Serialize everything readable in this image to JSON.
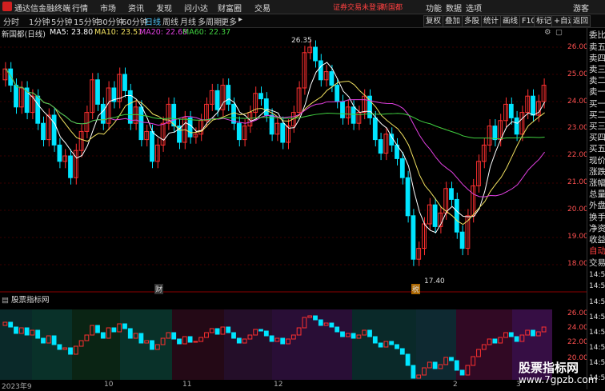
{
  "titlebar": {
    "app_name": "通达信金融终端",
    "menu": [
      "行情",
      "市场",
      "资讯",
      "发现",
      "问小达",
      "财富圈",
      "交易"
    ],
    "notice": "证券交易未登录",
    "stock": "新国都",
    "right_menu": [
      "功能",
      "数据",
      "选项"
    ],
    "user": "游客"
  },
  "toolbar": {
    "periods": [
      "分时",
      "1分钟",
      "5分钟",
      "15分钟",
      "30分钟",
      "60分钟",
      "日线",
      "周线",
      "月线",
      "多周期",
      "更多"
    ],
    "active_period": "日线",
    "buttons": [
      "复权",
      "叠加",
      "多股",
      "统计",
      "画线",
      "F10",
      "标记",
      "+自选",
      "返回"
    ]
  },
  "legend": {
    "title": "新国都(日线)",
    "ma": [
      {
        "label": "MA5: 23.80",
        "color": "#ffffff"
      },
      {
        "label": "MA10: 23.51",
        "color": "#f0e060"
      },
      {
        "label": "MA20: 22.68",
        "color": "#e040e0"
      },
      {
        "label": "MA60: 22.37",
        "color": "#40d040"
      }
    ]
  },
  "price_axis": [
    "26.00",
    "25.00",
    "24.00",
    "23.00",
    "22.00",
    "21.00",
    "20.00",
    "19.00",
    "18.00"
  ],
  "indicator_axis": [
    "26.00",
    "24.00",
    "22.00",
    "20.00"
  ],
  "annotations": {
    "high": "26.35",
    "low": "17.40",
    "marker1": "财",
    "marker2": "税"
  },
  "indicator_title": "股票指标网",
  "x_axis": [
    "2023年9",
    "10",
    "11",
    "12",
    "2",
    "3"
  ],
  "right_panel": [
    "委比",
    "卖五",
    "卖四",
    "卖三",
    "卖二",
    "卖一",
    "买一",
    "买二",
    "买三",
    "买四",
    "买五",
    "现价",
    "涨跌",
    "涨幅",
    "总量",
    "外盘",
    "换手",
    "净资",
    "收益",
    "自动",
    "交易",
    "14:50",
    "14:50",
    "14:50",
    "14:50",
    "14:50",
    "14:50",
    "14:50",
    "14:50"
  ],
  "watermark": {
    "line1": "股票指标网",
    "line2": "www.7gpzb.com"
  },
  "colors": {
    "up": "#ff3030",
    "down": "#00e5ff",
    "ma5": "#ffffff",
    "ma10": "#f0e060",
    "ma20": "#e040e0",
    "ma60": "#40d040"
  }
}
